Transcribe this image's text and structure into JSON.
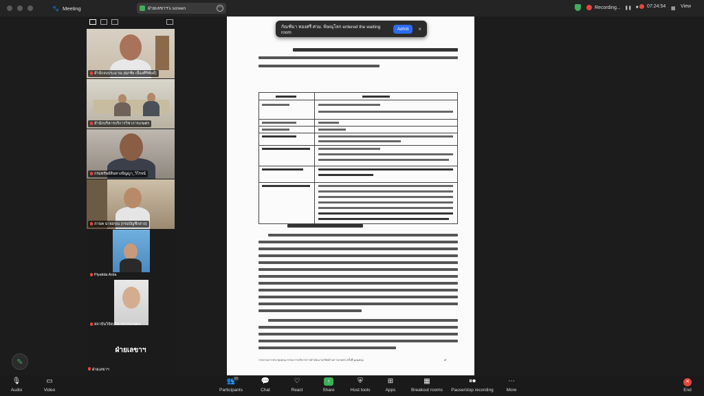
{
  "titlebar": {
    "app_name": "Meeting",
    "share_title": "ฝ่ายเลขาฯ's screen",
    "recording_label": "Recording...",
    "time": "07:24:54",
    "view_label": "View"
  },
  "notification": {
    "text": "กัณฑิมา ทองศรี ศวม. พิษณุโลก entered the waiting room",
    "admit_label": "Admit",
    "close_glyph": "×"
  },
  "participants": [
    {
      "name": "สำนักงบประมาณ (ศุภชัย เนื่องศิริพันธ์)"
    },
    {
      "name": "สำนักบริหารบริการวิชาการเกษตร"
    },
    {
      "name": "กรมทรัพย์สินทางปัญญา_วิโรจน์"
    },
    {
      "name": "ภานพ ฉายอรุณ (กรมบัญชีกลาง)"
    },
    {
      "name": "Piyatida Arda"
    },
    {
      "name": "สถาบันวิจัยบริหารการเกษตร"
    }
  ],
  "secretary_tile": {
    "big_label": "ฝ่ายเลขาฯ",
    "small_label": "ฝ่ายเลขาฯ"
  },
  "document": {
    "footer": "รายงานการประชุมคณะกรรมการบริหารการดำเนินงานวิจัยด้านการเกษตร ครั้งที่ ๑/๒๕๖๖",
    "page_number": "๙"
  },
  "toolbar": {
    "items": [
      {
        "label": "Audio",
        "icon": "microphone-icon"
      },
      {
        "label": "Video",
        "icon": "video-camera-icon"
      },
      {
        "label": "Participants",
        "icon": "participants-icon",
        "count": "10"
      },
      {
        "label": "Chat",
        "icon": "chat-icon"
      },
      {
        "label": "React",
        "icon": "heart-icon"
      },
      {
        "label": "Share",
        "icon": "share-screen-icon"
      },
      {
        "label": "Host tools",
        "icon": "shield-icon"
      },
      {
        "label": "Apps",
        "icon": "apps-icon"
      },
      {
        "label": "Breakout rooms",
        "icon": "breakout-rooms-icon"
      },
      {
        "label": "Pause/stop recording",
        "icon": "pause-record-icon"
      },
      {
        "label": "More",
        "icon": "more-icon"
      },
      {
        "label": "End",
        "icon": "end-call-icon"
      }
    ]
  },
  "colors": {
    "accent_green": "#3fae5a",
    "record_red": "#e8443a",
    "admit_blue": "#2d6cf0",
    "background": "#1c1c1c"
  }
}
